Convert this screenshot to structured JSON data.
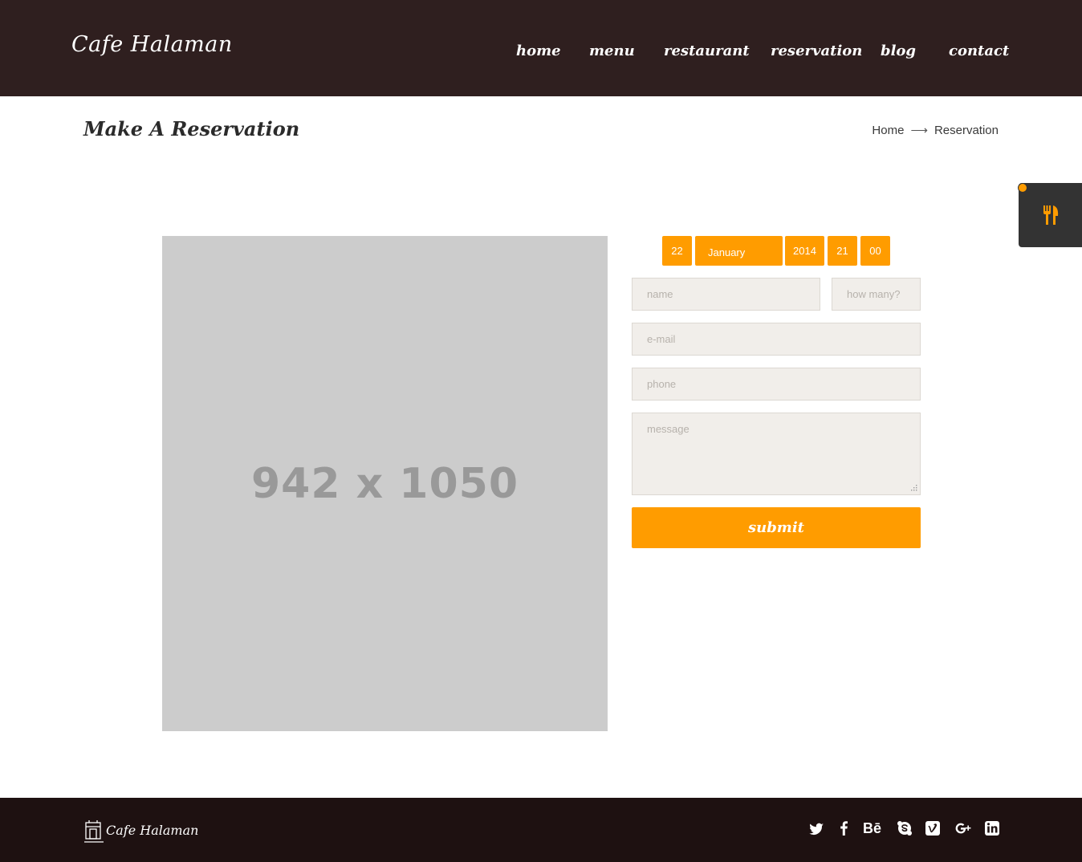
{
  "header": {
    "logo": "Cafe Halaman",
    "nav": [
      "home",
      "menu",
      "restaurant",
      "reservation",
      "blog",
      "contact"
    ]
  },
  "title_bar": {
    "title": "Make A Reservation",
    "breadcrumb": {
      "home": "Home",
      "current": "Reservation"
    }
  },
  "image_placeholder": {
    "label": "942 x 1050"
  },
  "reservation": {
    "date": {
      "day": "22",
      "month": "January",
      "year": "2014",
      "hour": "21",
      "minute": "00"
    },
    "fields": {
      "name_placeholder": "name",
      "how_many_placeholder": "how many?",
      "email_placeholder": "e-mail",
      "phone_placeholder": "phone",
      "message_placeholder": "message"
    },
    "submit_label": "submit"
  },
  "footer": {
    "logo": "Cafe Halaman",
    "social": [
      "twitter-icon",
      "facebook-icon",
      "behance-icon",
      "skype-icon",
      "vimeo-icon",
      "google-plus-icon",
      "linkedin-icon"
    ],
    "behance_text": "Bē"
  },
  "colors": {
    "header_bg": "#2f1f1f",
    "accent": "#ff9c00",
    "footer_bg": "#1e1111",
    "field_bg": "#f1eeea"
  }
}
